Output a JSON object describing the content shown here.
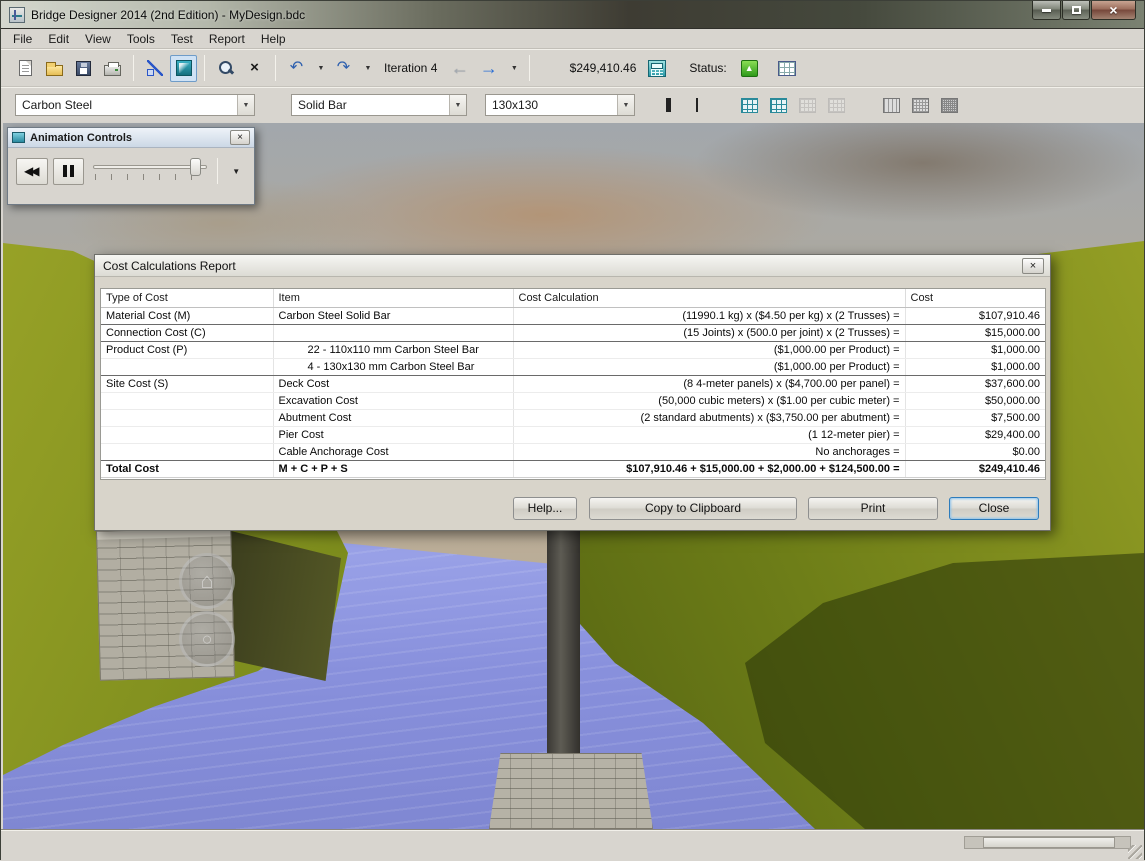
{
  "window": {
    "title": "Bridge Designer 2014 (2nd Edition) - MyDesign.bdc"
  },
  "menu": {
    "items": [
      "File",
      "Edit",
      "View",
      "Tools",
      "Test",
      "Report",
      "Help"
    ]
  },
  "toolbar": {
    "iteration": "Iteration 4",
    "cost": "$249,410.46",
    "status_label": "Status:"
  },
  "selectors": {
    "material": "Carbon Steel",
    "section": "Solid Bar",
    "size": "130x130"
  },
  "animation_controls": {
    "title": "Animation Controls"
  },
  "cost_report": {
    "title": "Cost Calculations Report",
    "columns": [
      "Type of Cost",
      "Item",
      "Cost Calculation",
      "Cost"
    ],
    "rows": [
      {
        "type": "Material Cost (M)",
        "item": "Carbon Steel Solid Bar",
        "calc": "(11990.1 kg) x ($4.50 per kg) x (2 Trusses) =",
        "cost": "$107,910.46",
        "divider": "strong"
      },
      {
        "type": "Connection Cost (C)",
        "item": "",
        "calc": "(15 Joints) x (500.0 per joint) x (2 Trusses) =",
        "cost": "$15,000.00",
        "divider": "strong"
      },
      {
        "type": "Product Cost (P)",
        "item": "22 - 110x110 mm Carbon Steel Bar",
        "calc": "($1,000.00 per Product) =",
        "cost": "$1,000.00",
        "divider": "light",
        "indent": true
      },
      {
        "type": "",
        "item": "4 - 130x130 mm Carbon Steel Bar",
        "calc": "($1,000.00 per Product) =",
        "cost": "$1,000.00",
        "divider": "strong",
        "indent": true
      },
      {
        "type": "Site Cost (S)",
        "item": "Deck Cost",
        "calc": "(8 4-meter panels) x ($4,700.00 per panel) =",
        "cost": "$37,600.00",
        "divider": "light"
      },
      {
        "type": "",
        "item": "Excavation Cost",
        "calc": "(50,000 cubic meters) x ($1.00 per cubic meter) =",
        "cost": "$50,000.00",
        "divider": "light"
      },
      {
        "type": "",
        "item": "Abutment Cost",
        "calc": "(2 standard abutments) x ($3,750.00 per abutment) =",
        "cost": "$7,500.00",
        "divider": "light"
      },
      {
        "type": "",
        "item": "Pier Cost",
        "calc": "(1 12-meter pier) =",
        "cost": "$29,400.00",
        "divider": "light"
      },
      {
        "type": "",
        "item": "Cable Anchorage Cost",
        "calc": "No anchorages =",
        "cost": "$0.00",
        "divider": "strong"
      },
      {
        "type": "Total Cost",
        "item": "M + C + P + S",
        "calc": "$107,910.46 + $15,000.00 + $2,000.00 + $124,500.00 =",
        "cost": "$249,410.46",
        "bold": true
      }
    ],
    "buttons": {
      "help": "Help...",
      "copy": "Copy to Clipboard",
      "print": "Print",
      "close": "Close"
    }
  },
  "icons": {
    "close": "×",
    "dropdown": "▼",
    "undo": "↶",
    "redo": "↷",
    "back_arrow": "←",
    "forward_arrow": "→",
    "delete": "×",
    "rewind": "◀◀",
    "status_up": "▲",
    "overlay_home": "⌂",
    "overlay_ring": "○"
  },
  "colors": {
    "accent_blue": "#2b6fd4",
    "status_green": "#2f9a1a",
    "water_blue": "#8890dc",
    "selection_highlight": "#cfe2f5"
  }
}
